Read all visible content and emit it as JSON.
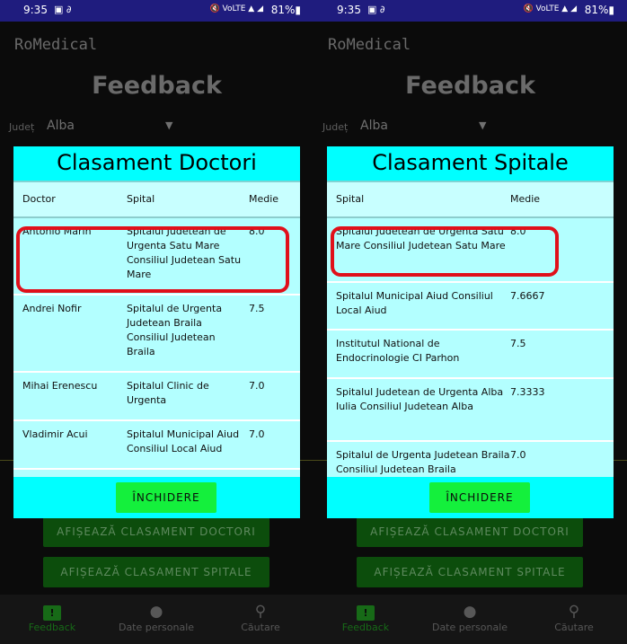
{
  "left": {
    "status": {
      "time": "9:35",
      "left_icons": "▣ ∂",
      "right_icons": "🔇 VoLTE ▲ ◢",
      "battery": "81%▮"
    },
    "app_title": "RoMedical",
    "page_title": "Feedback",
    "county_label": "Județ",
    "county_value": "Alba",
    "bg_buttons": {
      "doctori": "AFIȘEAZĂ CLASAMENT DOCTORI",
      "spitale": "AFIȘEAZĂ CLASAMENT SPITALE"
    },
    "nav": [
      {
        "label": "Feedback",
        "icon": "feedback-icon",
        "active": true
      },
      {
        "label": "Date personale",
        "icon": "person-icon",
        "active": false
      },
      {
        "label": "Căutare",
        "icon": "search-icon",
        "active": false
      }
    ],
    "dialog": {
      "title": "Clasament Doctori",
      "headers": {
        "doctor": "Doctor",
        "spital": "Spital",
        "medie": "Medie"
      },
      "rows": [
        {
          "doctor": "Antonio Marin",
          "spital": "Spitalul Judetean de Urgenta Satu Mare Consiliul Judetean Satu Mare",
          "medie": "8.0"
        },
        {
          "doctor": "Andrei Nofir",
          "spital": "Spitalul de Urgenta Judetean Braila Consiliul Judetean Braila",
          "medie": "7.5"
        },
        {
          "doctor": "Mihai Erenescu",
          "spital": "Spitalul Clinic de Urgenta",
          "medie": "7.0"
        },
        {
          "doctor": "Vladimir Acui",
          "spital": "Spitalul Municipal Aiud Consiliul Local Aiud",
          "medie": "7.0"
        }
      ],
      "close_label": "ÎNCHIDERE"
    }
  },
  "right": {
    "status": {
      "time": "9:35",
      "left_icons": "▣ ∂",
      "right_icons": "🔇 VoLTE ▲ ◢",
      "battery": "81%▮"
    },
    "app_title": "RoMedical",
    "page_title": "Feedback",
    "county_label": "Județ",
    "county_value": "Alba",
    "bg_buttons": {
      "doctori": "AFIȘEAZĂ CLASAMENT DOCTORI",
      "spitale": "AFIȘEAZĂ CLASAMENT SPITALE"
    },
    "nav": [
      {
        "label": "Feedback",
        "icon": "feedback-icon",
        "active": true
      },
      {
        "label": "Date personale",
        "icon": "person-icon",
        "active": false
      },
      {
        "label": "Căutare",
        "icon": "search-icon",
        "active": false
      }
    ],
    "dialog": {
      "title": "Clasament Spitale",
      "headers": {
        "spital": "Spital",
        "medie": "Medie"
      },
      "rows": [
        {
          "spital": "Spitalul Judetean de Urgenta Satu Mare Consiliul Judetean Satu Mare",
          "medie": "8.0"
        },
        {
          "spital": "Spitalul Municipal Aiud Consiliul Local Aiud",
          "medie": "7.6667"
        },
        {
          "spital": "Institutul National de Endocrinologie CI Parhon",
          "medie": "7.5"
        },
        {
          "spital": "Spitalul Judetean de Urgenta Alba Iulia Consiliul Judetean Alba",
          "medie": "7.3333"
        },
        {
          "spital": "Spitalul de Urgenta Judetean Braila Consiliul Judetean Braila",
          "medie": "7.0"
        }
      ],
      "close_label": "ÎNCHIDERE"
    }
  },
  "colors": {
    "dialog": "#00ffff",
    "table": "#b3ffff",
    "close_button": "#14f03c",
    "highlight": "#e0101a",
    "status_bar": "#1f1c7e",
    "nav_active": "#176a17"
  }
}
